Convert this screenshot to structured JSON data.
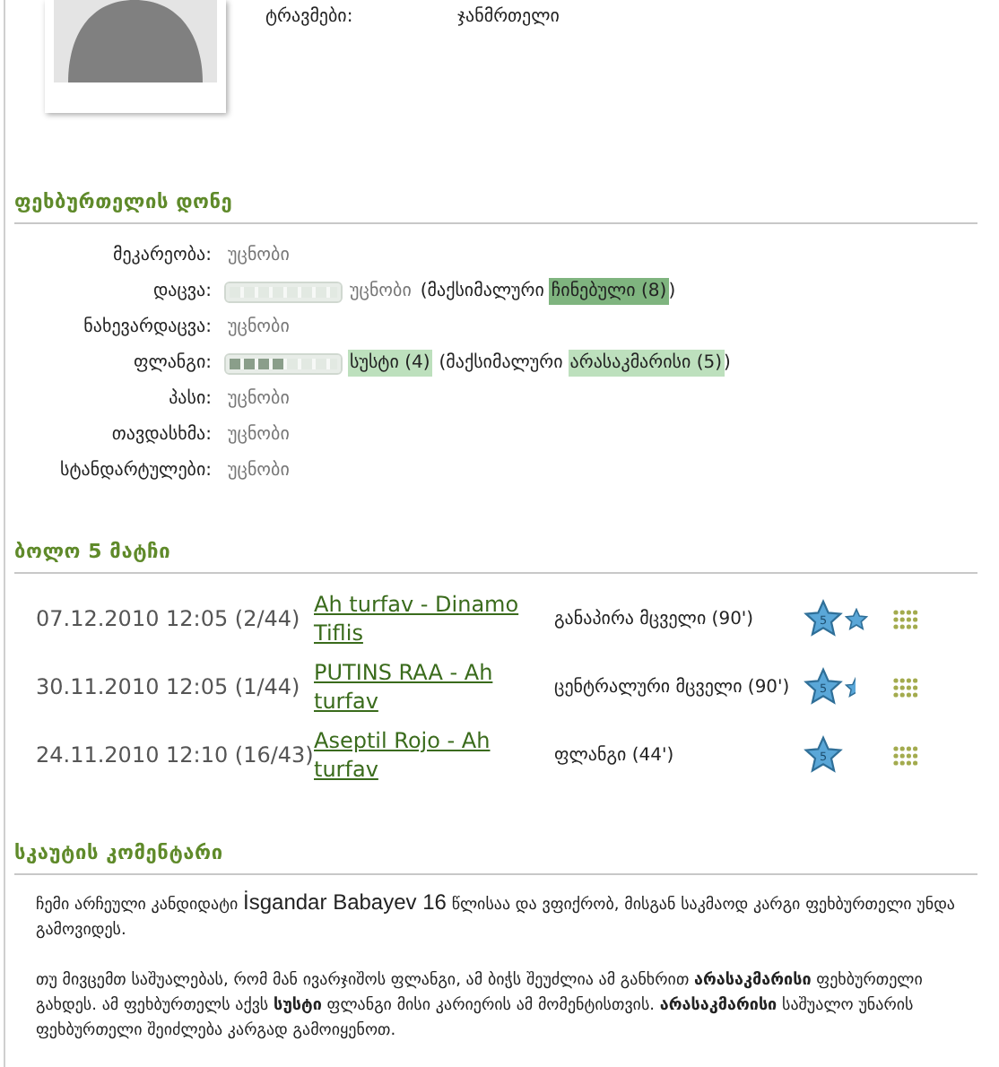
{
  "profile": {
    "fields": [
      {
        "label": "ტრავმები:",
        "value": "ჯანმრთელი"
      }
    ]
  },
  "skills_section": {
    "title": "ფეხბურთელის დონე",
    "skills": [
      {
        "kind": "plain",
        "label": "მეკარეობა:",
        "value": {
          "text": "უცნობი"
        }
      },
      {
        "kind": "bar",
        "label": "დაცვა:",
        "value": {
          "text": "უცნობი"
        },
        "max_text": "(მაქსიმალური",
        "max": {
          "text": "ჩინებული (8)",
          "color": "#7fb47f"
        },
        "max_close": ")"
      },
      {
        "kind": "plain",
        "label": "ნახევარდაცვა:",
        "value": {
          "text": "უცნობი"
        }
      },
      {
        "kind": "bar",
        "label": "ფლანგი:",
        "level": 0.5,
        "value": {
          "text": "სუსტი (4)",
          "color": "#bde0bd"
        },
        "max_text": "(მაქსიმალური",
        "max": {
          "text": "არასაკმარისი (5)",
          "color": "#bde0bd"
        },
        "max_close": ")"
      },
      {
        "kind": "plain",
        "label": "პასი:",
        "value": {
          "text": "უცნობი"
        }
      },
      {
        "kind": "plain",
        "label": "თავდასხმა:",
        "value": {
          "text": "უცნობი"
        }
      },
      {
        "kind": "plain",
        "label": "სტანდარტულები:",
        "value": {
          "text": "უცნობი"
        }
      }
    ]
  },
  "matches_section": {
    "title": "ბოლო 5 მატჩი",
    "matches": [
      {
        "date": "07.12.2010 12:05 (2/44)",
        "match": "Ah turfav - Dinamo Tiflis",
        "position": "განაპირა მცველი (90')",
        "rating_icons": [
          {
            "kind": "big",
            "text": "5"
          },
          {
            "kind": "small"
          }
        ]
      },
      {
        "date": "30.11.2010 12:05 (1/44)",
        "match": "PUTINS RAA - Ah turfav",
        "position": "ცენტრალური მცველი (90')",
        "rating_icons": [
          {
            "kind": "big",
            "text": "5"
          },
          {
            "kind": "half"
          }
        ]
      },
      {
        "date": "24.11.2010 12:10 (16/43)",
        "match": "Aseptil Rojo - Ah turfav",
        "position": "ფლანგი (44')",
        "rating_icons": [
          {
            "kind": "big",
            "text": "5"
          }
        ]
      }
    ]
  },
  "scout_section": {
    "title": "სკაუტის კომენტარი",
    "paragraphs": [
      {
        "segments": [
          {
            "kind": "georgian",
            "text": "ჩემი არჩეული კანდიდატი "
          },
          {
            "kind": "latin",
            "text": "İsgandar Babayev 16"
          },
          {
            "kind": "georgian",
            "text": " წლისაა და ვფიქრობ, მისგან საკმაოდ კარგი ფეხბურთელი უნდა გამოვიდეს."
          }
        ]
      },
      {
        "segments": [
          {
            "kind": "georgian",
            "text": "თუ მივცემთ საშუალებას, რომ მან ივარჯიშოს ფლანგი, ამ ბიჭს შეუძლია ამ განხრით **არასაკმარისი** ფეხბურთელი გახდეს. ამ ფეხბურთელს აქვს **სუსტი** ფლანგი მისი კარიერის ამ მომენტისთვის. **არასაკმარისი** საშუალო უნარის ფეხბურთელი შეიძლება კარგად გამოიყენოთ."
          }
        ]
      }
    ]
  }
}
